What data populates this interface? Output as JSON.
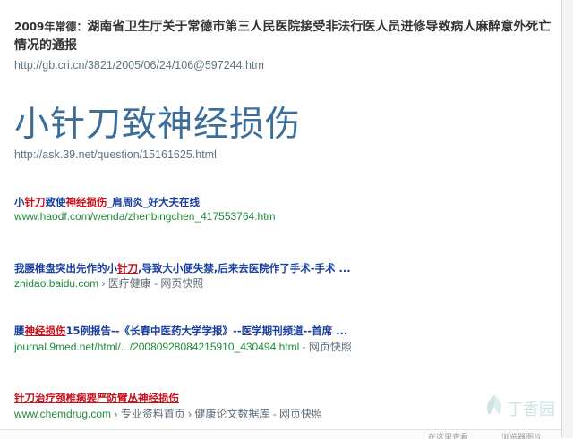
{
  "news": {
    "prefix": "2009年常德：",
    "title": "湖南省卫生厅关于常德市第三人民医院接受非法行医人员进修导致病人麻醉意外死亡情况的通报",
    "url": "http://gb.cri.cn/3821/2005/06/24/106@597244.htm"
  },
  "query": {
    "title": "小针刀致神经损伤",
    "url": "http://ask.39.net/question/15161625.html"
  },
  "results": [
    {
      "title_parts": [
        "小",
        "针刀",
        "致使",
        "神经损伤",
        "_肩周炎_好大夫在线"
      ],
      "url": "www.haodf.com/wenda/zhenbingchen_417553764.htm",
      "extra": ""
    },
    {
      "title_parts": [
        "我腰椎盘突出先作的小",
        "针刀",
        ",导致大小便失禁,后来去医院作了手术-手术 ..."
      ],
      "url": "zhidao.baidu.com",
      "extra": "› 医疗健康 - 网页快照"
    },
    {
      "title_parts": [
        "腰",
        "神经损伤",
        "15例报告--《长春中医药大学学报》--医学期刊频道--首席 ..."
      ],
      "url": "journal.9med.net/html/.../20080928084215910_430494.html",
      "extra": "- 网页快照"
    },
    {
      "title_parts": [
        "针刀治疗颈椎病要严防臂丛神经损伤"
      ],
      "url": "www.chemdrug.com",
      "extra": "› 专业资料首页 › 健康论文数据库 - 网页快照"
    }
  ],
  "watermark": {
    "text": "丁香园",
    "color": "#2a8a8a"
  },
  "bottom_bar": {
    "item1": "在这里查看",
    "item2": "浏览器图片"
  }
}
